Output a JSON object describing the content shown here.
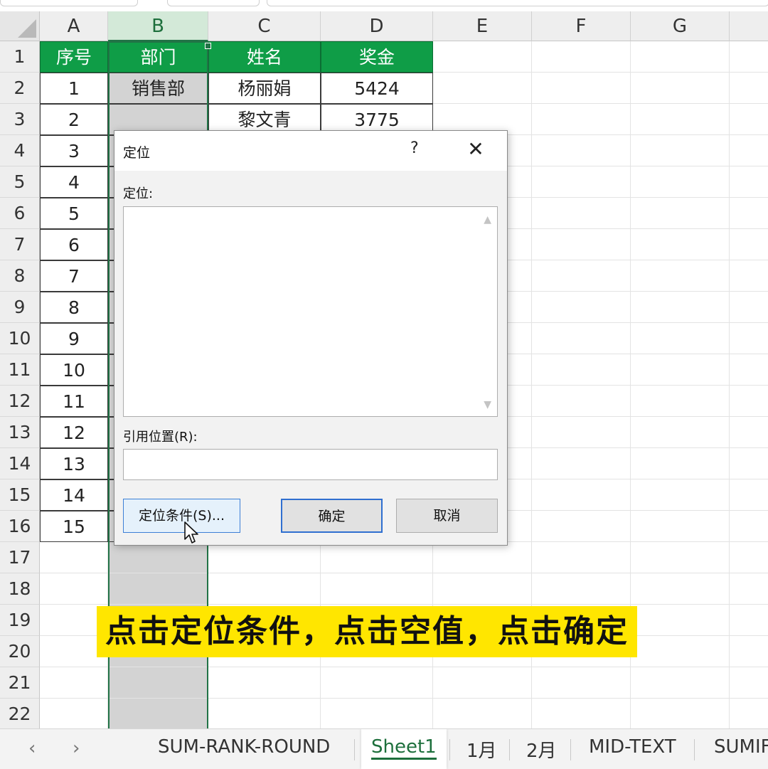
{
  "columns": [
    "A",
    "B",
    "C",
    "D",
    "E",
    "F",
    "G"
  ],
  "rows": [
    "1",
    "2",
    "3",
    "4",
    "5",
    "6",
    "7",
    "8",
    "9",
    "10",
    "11",
    "12",
    "13",
    "14",
    "15",
    "16",
    "17",
    "18",
    "19",
    "20",
    "21",
    "22"
  ],
  "table": {
    "headers": [
      "序号",
      "部门",
      "姓名",
      "奖金"
    ],
    "serials": [
      "1",
      "2",
      "3",
      "4",
      "5",
      "6",
      "7",
      "8",
      "9",
      "10",
      "11",
      "12",
      "13",
      "14",
      "15"
    ],
    "row2": {
      "dept": "销售部",
      "name": "杨丽娟",
      "bonus": "5424"
    },
    "row3": {
      "name": "黎文青",
      "bonus": "3775"
    }
  },
  "dialog": {
    "title": "定位",
    "help": "?",
    "close": "✕",
    "goto_label": "定位:",
    "reference_label": "引用位置(R):",
    "special_button": "定位条件(S)...",
    "ok_button": "确定",
    "cancel_button": "取消"
  },
  "caption": "点击定位条件，点击空值，点击确定",
  "sheet_tabs": [
    "SUM-RANK-ROUND",
    "Sheet1",
    "1月",
    "2月",
    "MID-TEXT",
    "SUMIF"
  ],
  "active_tab": "Sheet1",
  "colors": {
    "header_green": "#0f9d47",
    "selection_green": "#217346",
    "caption_yellow": "#ffe600",
    "column_b_fill": "#d3d3d3"
  }
}
